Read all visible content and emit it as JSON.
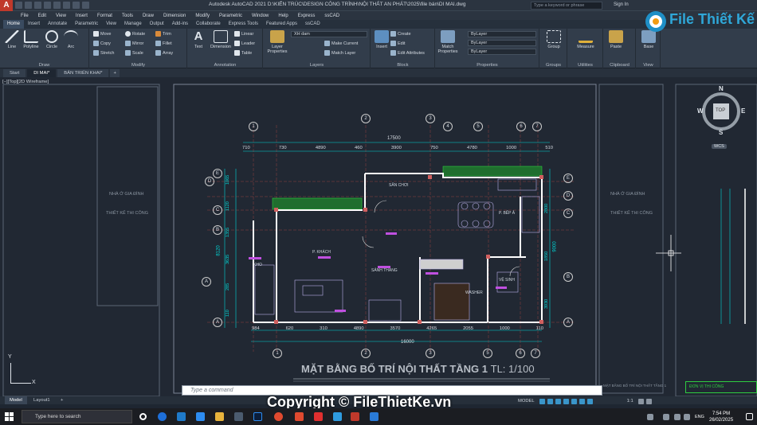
{
  "window": {
    "title": "Autodesk AutoCAD 2021   D:\\KIẾN TRÚC\\DESIGN CÔNG TRÌNH\\NỘI THẤT AN PHÁT\\2025\\file bán\\DI MAI.dwg",
    "search_placeholder": "Type a keyword or phrase",
    "sign_in": "Sign In"
  },
  "menu": [
    "File",
    "Edit",
    "View",
    "Insert",
    "Format",
    "Tools",
    "Draw",
    "Dimension",
    "Modify",
    "Parametric",
    "Window",
    "Help",
    "Express",
    "ssCAD"
  ],
  "ribbon_tabs": [
    "Home",
    "Insert",
    "Annotate",
    "Parametric",
    "View",
    "Manage",
    "Output",
    "Add-ins",
    "Collaborate",
    "Express Tools",
    "Featured Apps",
    "ssCAD"
  ],
  "ribbon": {
    "draw": {
      "label": "Draw",
      "line": "Line",
      "polyline": "Polyline",
      "circle": "Circle",
      "arc": "Arc"
    },
    "modify": {
      "label": "Modify",
      "move": "Move",
      "rotate": "Rotate",
      "trim": "Trim",
      "copy": "Copy",
      "mirror": "Mirror",
      "fillet": "Fillet",
      "stretch": "Stretch",
      "scale": "Scale",
      "array": "Array"
    },
    "annotation": {
      "label": "Annotation",
      "text": "Text",
      "dimension": "Dimension",
      "linear": "Linear",
      "leader": "Leader",
      "table": "Table"
    },
    "layers": {
      "label": "Layers",
      "layer_properties": "Layer Properties",
      "current_layer": "XH dam",
      "make_current": "Make Current",
      "match_layer": "Match Layer"
    },
    "block": {
      "label": "Block",
      "insert": "Insert",
      "create": "Create",
      "edit": "Edit",
      "edit_attributes": "Edit Attributes"
    },
    "properties": {
      "label": "Properties",
      "match": "Match Properties",
      "color": "ByLayer",
      "linetype": "ByLayer",
      "lineweight": "ByLayer"
    },
    "groups": {
      "label": "Groups",
      "group": "Group"
    },
    "utilities": {
      "label": "Utilities",
      "measure": "Measure"
    },
    "clipboard": {
      "label": "Clipboard",
      "paste": "Paste"
    },
    "view": {
      "label": "View",
      "base": "Base"
    }
  },
  "file_tabs": [
    "Start",
    "DI MAI*",
    "BẢN TRIỂN KHAI*"
  ],
  "viewport_label": "[−][Top][2D Wireframe]",
  "drawing": {
    "title": "MẶT BẰNG BỐ TRÍ NỘI THẤT TẦNG 1",
    "scale": "TL: 1/100",
    "dim_top_total": "17500",
    "dim_top": [
      "710",
      "730",
      "4890",
      "460",
      "3900",
      "750",
      "4780",
      "1000",
      "510"
    ],
    "dim_bottom_total": "16000",
    "dim_bottom": [
      "984",
      "620",
      "310",
      "4890",
      "3570",
      "4265",
      "2055",
      "1000",
      "110"
    ],
    "dim_left": [
      "1065",
      "1120",
      "1355",
      "3635",
      "8120",
      "285",
      "110"
    ],
    "dim_right": [
      "2800",
      "1850",
      "3930",
      "9000"
    ],
    "grid_top": [
      "1",
      "2",
      "3",
      "4",
      "5",
      "6",
      "7"
    ],
    "grid_bottom": [
      "1",
      "2",
      "3",
      "4",
      "5",
      "6",
      "7"
    ],
    "grid_left": [
      "E",
      "D",
      "C",
      "B",
      "A",
      "A"
    ],
    "grid_right": [
      "E",
      "D",
      "C",
      "B",
      "A"
    ],
    "rooms": [
      "SÂN CHƠI",
      "P. BẾP Ă",
      "P. KHÁCH",
      "SẢNH THANG",
      "KHO",
      "VỆ SINH",
      "WASHER"
    ],
    "title_block": {
      "project": "NHÀ Ở GIA ĐÌNH",
      "phase": "THIẾT KẾ THI CÔNG",
      "right_note": "MẶT BẰNG BỐ TRÍ NỘI THẤT TẦNG 1",
      "contractor": "ĐƠN VỊ THI CÔNG"
    }
  },
  "compass": {
    "n": "N",
    "s": "S",
    "e": "E",
    "w": "W",
    "top": "TOP",
    "wcs": "WCS"
  },
  "ucs": {
    "x": "X",
    "y": "Y"
  },
  "layout_tabs": [
    "Model",
    "Layout1"
  ],
  "command_placeholder": "Type a command",
  "status": {
    "mode": "MODEL",
    "scale": "1:1"
  },
  "taskbar": {
    "search_placeholder": "Type here to search",
    "lang": "ENG",
    "time": "7:54 PM",
    "date": "26/02/2025"
  },
  "watermark": {
    "copyright": "Copyright © FileThietKe.vn",
    "logo": "File Thiết Kế .vn"
  },
  "colors": {
    "accent": "#3a95c9",
    "cad_wall": "#ffffff",
    "cad_dim": "#00ffff",
    "cad_grid": "#ff0000",
    "cad_green": "#1fa33a",
    "cad_magenta": "#c050e0"
  }
}
